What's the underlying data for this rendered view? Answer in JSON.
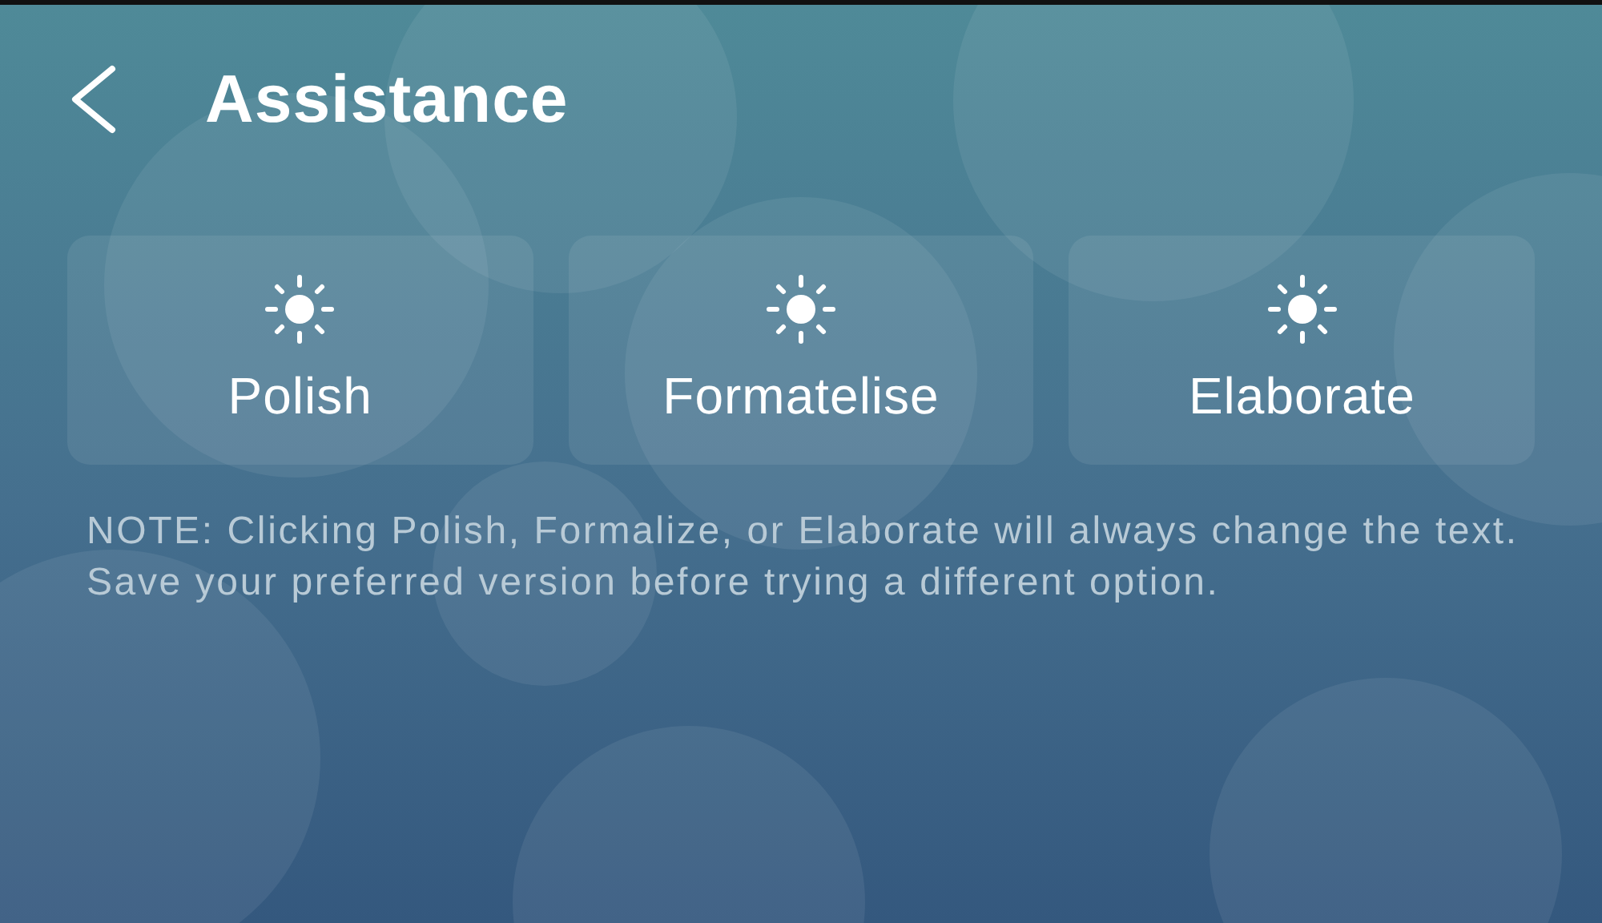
{
  "header": {
    "title": "Assistance"
  },
  "actions": [
    {
      "label": "Polish"
    },
    {
      "label": "Formatelise"
    },
    {
      "label": "Elaborate"
    }
  ],
  "note": "NOTE: Clicking Polish, Formalize, or Elaborate will always change the text. Save your preferred version before trying a different option."
}
